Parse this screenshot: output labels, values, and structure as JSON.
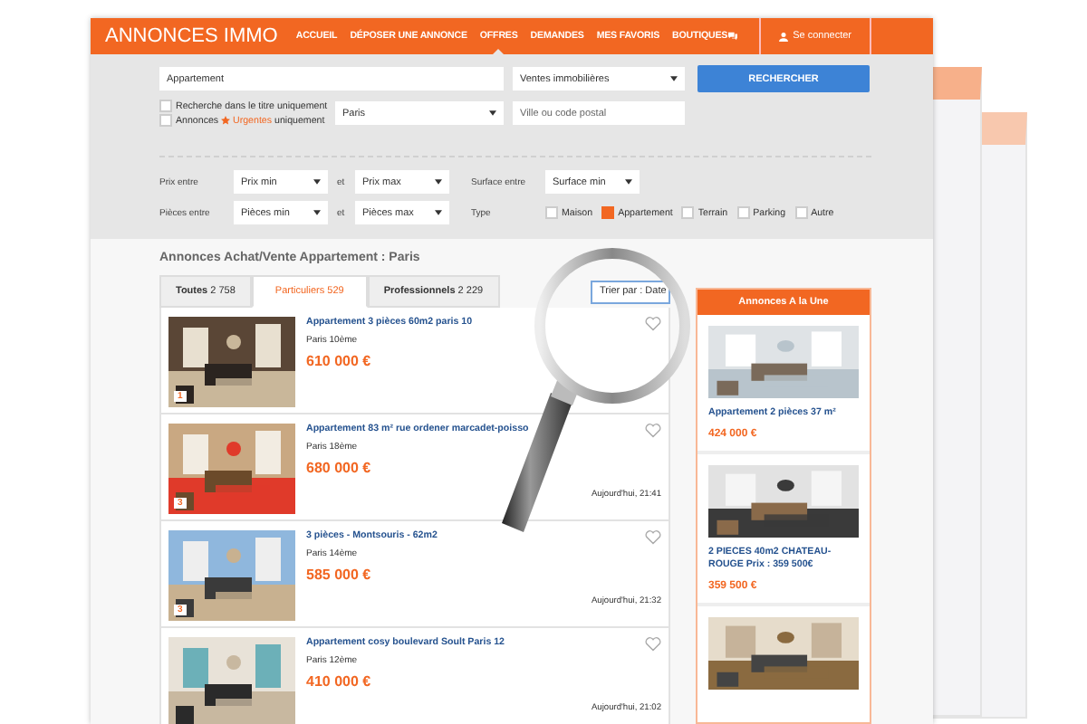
{
  "header": {
    "logo": "ANNONCES IMMO",
    "nav": [
      {
        "label": "ACCUEIL",
        "selected": false
      },
      {
        "label": "DÉPOSER UNE ANNONCE",
        "selected": false
      },
      {
        "label": "OFFRES",
        "selected": true
      },
      {
        "label": "DEMANDES",
        "selected": false
      },
      {
        "label": "MES FAVORIS",
        "selected": false
      },
      {
        "label": "BOUTIQUES",
        "selected": false
      }
    ],
    "login": "Se connecter"
  },
  "search": {
    "query": "Appartement",
    "category": "Ventes immobilières",
    "button": "RECHERCHER",
    "title_only": {
      "label": "Recherche dans le titre uniquement",
      "checked": false
    },
    "urgent": {
      "before": "Annonces",
      "urgent": "Urgentes",
      "after": "uniquement",
      "checked": false
    },
    "region": "Paris",
    "city_placeholder": "Ville ou code postal"
  },
  "filters": {
    "price_label": "Prix entre",
    "price_min": "Prix min",
    "and_1": "et",
    "price_max": "Prix max",
    "surface_label": "Surface entre",
    "surface_min": "Surface min",
    "rooms_label": "Pièces entre",
    "rooms_min": "Pièces min",
    "and_2": "et",
    "rooms_max": "Pièces max",
    "type_label": "Type",
    "types": [
      {
        "label": "Maison",
        "checked": false
      },
      {
        "label": "Appartement",
        "checked": true
      },
      {
        "label": "Terrain",
        "checked": false
      },
      {
        "label": "Parking",
        "checked": false
      },
      {
        "label": "Autre",
        "checked": false
      }
    ]
  },
  "listing": {
    "heading": "Annonces Achat/Vente Appartement : Paris",
    "tabs": [
      {
        "label": "Toutes",
        "count": "2 758",
        "selected": false
      },
      {
        "label": "Particuliers",
        "count": "529",
        "selected": true
      },
      {
        "label": "Professionnels",
        "count": "2 229",
        "selected": false
      }
    ],
    "sort": "Trier par : Date",
    "ads": [
      {
        "title": "Appartement 3 pièces 60m2 paris 10",
        "location": "Paris 10ème",
        "price": "610 000 €",
        "photos": "1"
      },
      {
        "title": "Appartement 83 m² rue ordener marcadet-poisso",
        "location": "Paris 18ème",
        "price": "680 000 €",
        "date": "Aujourd'hui, 21:41",
        "photos": "3"
      },
      {
        "title": "3 pièces - Montsouris - 62m2",
        "location": "Paris 14ème",
        "price": "585 000 €",
        "date": "Aujourd'hui, 21:32",
        "photos": "3"
      },
      {
        "title": "Appartement cosy boulevard Soult Paris 12",
        "location": "Paris 12ème",
        "price": "410 000 €",
        "date": "Aujourd'hui, 21:02"
      }
    ]
  },
  "featured": {
    "title": "Annonces A la Une",
    "items": [
      {
        "title": "Appartement 2 pièces 37 m²",
        "price": "424 000 €"
      },
      {
        "title": "2 PIECES 40m2 CHATEAU-ROUGE Prix : 359 500€",
        "price": "359 500 €"
      },
      {
        "kind": "picture"
      }
    ]
  }
}
